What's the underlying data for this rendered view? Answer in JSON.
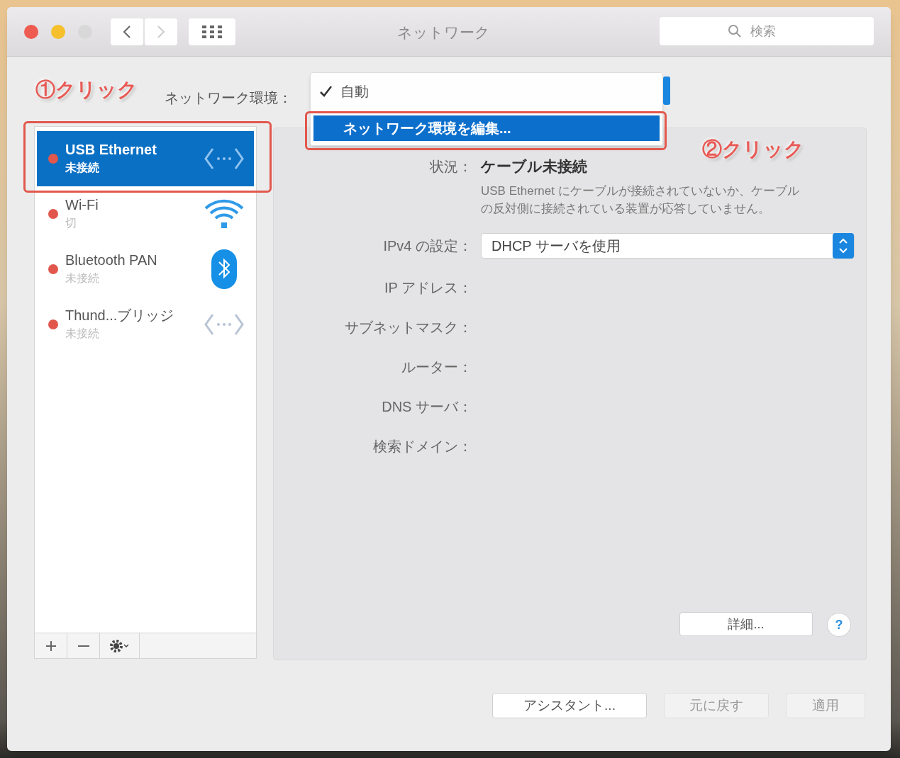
{
  "window": {
    "title": "ネットワーク",
    "search": {
      "placeholder": "検索"
    }
  },
  "annotations": [
    {
      "text": "①クリック"
    },
    {
      "text": "②クリック"
    }
  ],
  "location": {
    "label": "ネットワーク環境：",
    "menu": [
      {
        "label": "自動",
        "checked": true,
        "selected": false
      },
      {
        "label": "ネットワーク環境を編集...",
        "checked": false,
        "selected": true
      }
    ]
  },
  "services": [
    {
      "name": "USB Ethernet",
      "status": "未接続",
      "kind": "ethernet",
      "selected": true
    },
    {
      "name": "Wi-Fi",
      "status": "切",
      "kind": "wifi",
      "selected": false
    },
    {
      "name": "Bluetooth PAN",
      "status": "未接続",
      "kind": "bluetooth",
      "selected": false
    },
    {
      "name": "Thund...ブリッジ",
      "status": "未接続",
      "kind": "ethernet",
      "selected": false
    }
  ],
  "detail": {
    "status_label": "状況：",
    "status_value": "ケーブル未接続",
    "status_description": "USB Ethernet にケーブルが接続されていないか、ケーブルの反対側に接続されている装置が応答していません。",
    "ipv4_label": "IPv4 の設定：",
    "ipv4_value": "DHCP サーバを使用",
    "fields": [
      {
        "label": "IP アドレス："
      },
      {
        "label": "サブネットマスク："
      },
      {
        "label": "ルーター："
      },
      {
        "label": "DNS サーバ："
      },
      {
        "label": "検索ドメイン："
      }
    ],
    "advanced_button": "詳細...",
    "help_button": "?"
  },
  "buttons": [
    {
      "label": "アシスタント...",
      "disabled": false
    },
    {
      "label": "元に戻す",
      "disabled": true
    },
    {
      "label": "適用",
      "disabled": true
    }
  ]
}
